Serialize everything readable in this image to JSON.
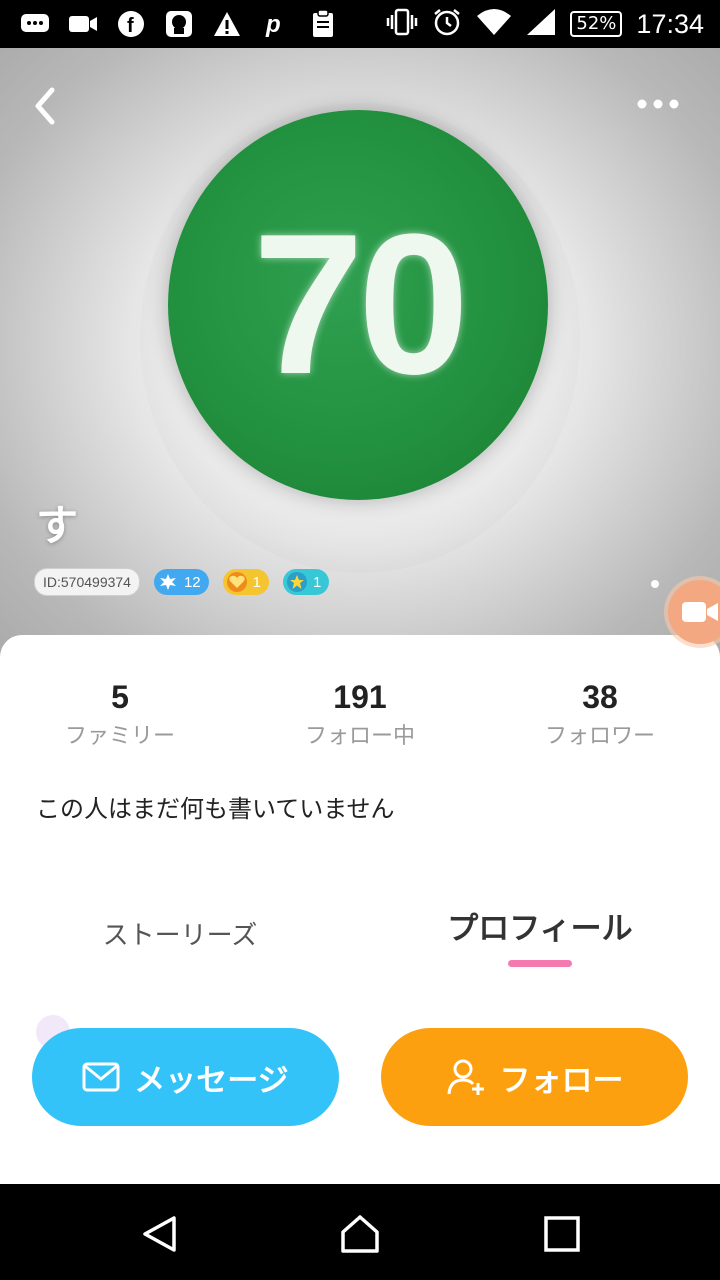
{
  "status_bar": {
    "battery": "52%",
    "time": "17:34",
    "icons": [
      "messaging-icon",
      "video-icon",
      "facebook-icon",
      "app-icon",
      "warning-icon",
      "p-icon",
      "clipboard-icon",
      "vibrate-icon",
      "alarm-icon",
      "wifi-icon",
      "signal-icon",
      "battery-icon"
    ]
  },
  "header": {
    "image_text": "70",
    "user_name": "す",
    "id_badge": "ID:570499374",
    "badges": [
      {
        "icon": "star-burst-icon",
        "value": "12"
      },
      {
        "icon": "heart-icon",
        "value": "1"
      },
      {
        "icon": "star-icon",
        "value": "1"
      }
    ]
  },
  "stats": [
    {
      "value": "5",
      "label": "ファミリー"
    },
    {
      "value": "191",
      "label": "フォロー中"
    },
    {
      "value": "38",
      "label": "フォロワー"
    }
  ],
  "bio": "この人はまだ何も書いていません",
  "tabs": {
    "stories": "ストーリーズ",
    "profile": "プロフィール"
  },
  "actions": {
    "message": "メッセージ",
    "follow": "フォロー"
  },
  "colors": {
    "message_button": "#34c3f8",
    "follow_button": "#fda010",
    "tab_underline": "#f47ab0"
  }
}
